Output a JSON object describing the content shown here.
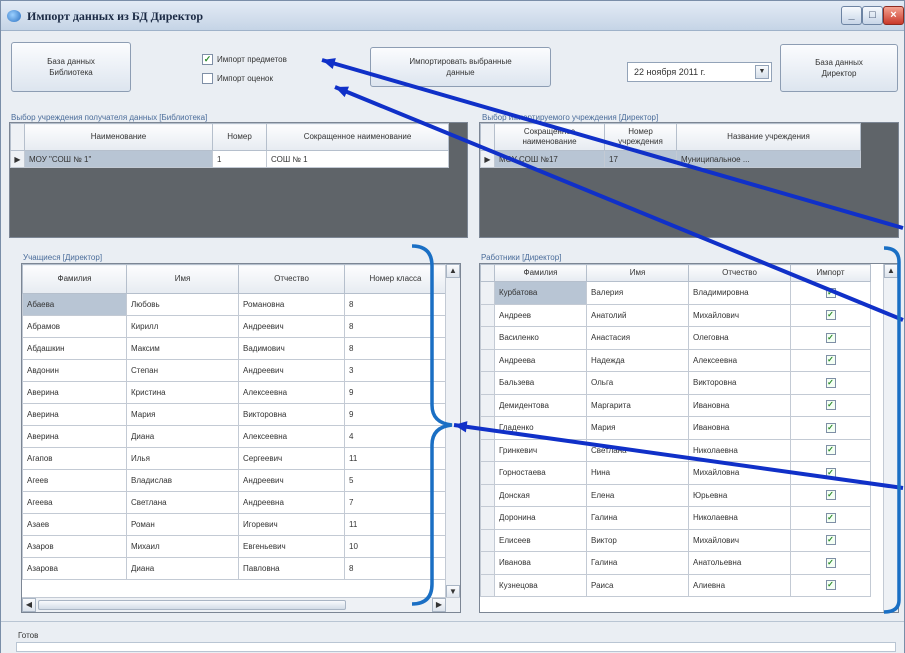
{
  "window": {
    "title": "Импорт данных из БД Директор"
  },
  "toolbar": {
    "library_db": "База данных\nБиблиотека",
    "import_subjects": "Импорт предметов",
    "import_grades": "Импорт оценок",
    "import_selected": "Импортировать выбранные\nданные",
    "date": "22  ноября  2011 г.",
    "director_db": "База данных\nДиректор"
  },
  "checkboxes": {
    "subjects_checked": true,
    "grades_checked": false
  },
  "institution_left": {
    "title": "Выбор учреждения получателя данных [Библиотека]",
    "headers": [
      "Наименование",
      "Номер",
      "Сокращенное наименование"
    ],
    "rows": [
      [
        "МОУ \"СОШ № 1\"",
        "1",
        "СОШ № 1"
      ]
    ]
  },
  "institution_right": {
    "title": "Выбор импортируемого учреждения [Директор]",
    "headers": [
      "Сокращенное наименование",
      "Номер учреждения",
      "Название учреждения"
    ],
    "rows": [
      [
        "МОУ СОШ №17",
        "17",
        "Муниципальное ..."
      ]
    ]
  },
  "students": {
    "title": "Учащиеся [Директор]",
    "headers": [
      "Фамилия",
      "Имя",
      "Отчество",
      "Номер класса"
    ],
    "rows": [
      [
        "Абаева",
        "Любовь",
        "Романовна",
        "8"
      ],
      [
        "Абрамов",
        "Кирилл",
        "Андреевич",
        "8"
      ],
      [
        "Абдашкин",
        "Максим",
        "Вадимович",
        "8"
      ],
      [
        "Авдонин",
        "Степан",
        "Андреевич",
        "3"
      ],
      [
        "Аверина",
        "Кристина",
        "Алексеевна",
        "9"
      ],
      [
        "Аверина",
        "Мария",
        "Викторовна",
        "9"
      ],
      [
        "Аверина",
        "Диана",
        "Алексеевна",
        "4"
      ],
      [
        "Агапов",
        "Илья",
        "Сергеевич",
        "11"
      ],
      [
        "Агеев",
        "Владислав",
        "Андреевич",
        "5"
      ],
      [
        "Агеева",
        "Светлана",
        "Андреевна",
        "7"
      ],
      [
        "Азаев",
        "Роман",
        "Игоревич",
        "11"
      ],
      [
        "Азаров",
        "Михаил",
        "Евгеньевич",
        "10"
      ],
      [
        "Азарова",
        "Диана",
        "Павловна",
        "8"
      ]
    ]
  },
  "workers": {
    "title": "Работники [Директор]",
    "headers": [
      "Фамилия",
      "Имя",
      "Отчество",
      "Импорт"
    ],
    "rows": [
      [
        "Курбатова",
        "Валерия",
        "Владимировна"
      ],
      [
        "Андреев",
        "Анатолий",
        "Михайлович"
      ],
      [
        "Василенко",
        "Анастасия",
        "Олеговна"
      ],
      [
        "Андреева",
        "Надежда",
        "Алексеевна"
      ],
      [
        "Бальзева",
        "Ольга",
        "Викторовна"
      ],
      [
        "Демидентова",
        "Маргарита",
        "Ивановна"
      ],
      [
        "Гладенко",
        "Мария",
        "Ивановна"
      ],
      [
        "Гринкевич",
        "Светлана",
        "Николаевна"
      ],
      [
        "Горностаева",
        "Нина",
        "Михайловна"
      ],
      [
        "Донская",
        "Елена",
        "Юрьевна"
      ],
      [
        "Доронина",
        "Галина",
        "Николаевна"
      ],
      [
        "Елисеев",
        "Виктор",
        "Михайлович"
      ],
      [
        "Иванова",
        "Галина",
        "Анатольевна"
      ],
      [
        "Кузнецова",
        "Раиса",
        "Алиевна"
      ]
    ]
  },
  "status": {
    "text": "Готов"
  },
  "colors": {
    "annotation_arrow": "#1030c8",
    "annotation_bracket": "#1a6fc4",
    "checkmark": "#2b8a2b"
  }
}
